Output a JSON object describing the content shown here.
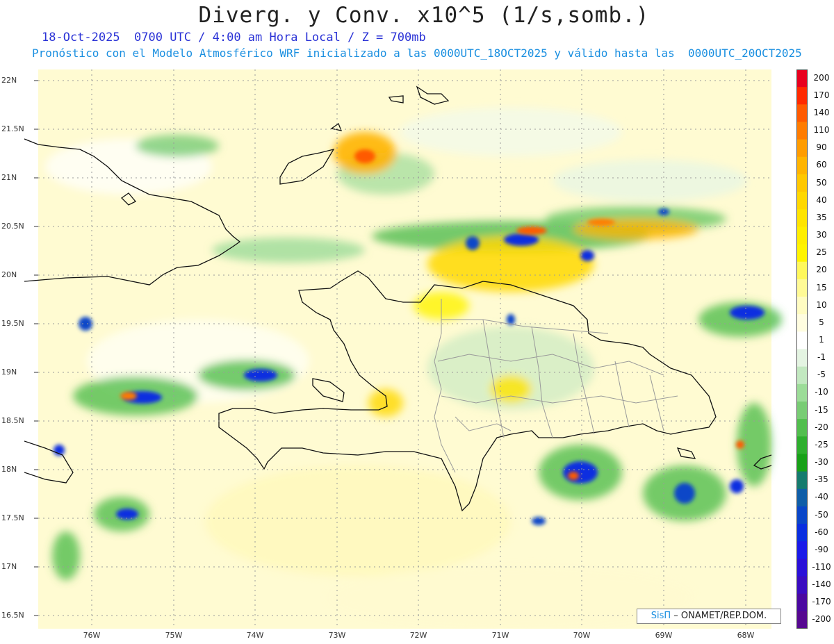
{
  "title": "Diverg. y Conv. x10^5 (1/s,somb.)",
  "subtitle_line1": "18-Oct-2025  0700 UTC / 4:00 am Hora Local / Z = 700mb",
  "subtitle_line2": "Pronóstico con el Modelo Atmosférico WRF inicializado a las 0000UTC_18OCT2025 y válido hasta las  0000UTC_20OCT2025",
  "lat_labels": [
    "22N",
    "21.5N",
    "21N",
    "20.5N",
    "20N",
    "19.5N",
    "19N",
    "18.5N",
    "18N",
    "17.5N",
    "17N",
    "16.5N"
  ],
  "lon_labels": [
    "76W",
    "75W",
    "74W",
    "73W",
    "72W",
    "71W",
    "70W",
    "69W",
    "68W"
  ],
  "colorbar": {
    "labels": [
      "200",
      "170",
      "140",
      "110",
      "90",
      "60",
      "50",
      "40",
      "35",
      "30",
      "25",
      "20",
      "15",
      "10",
      "5",
      "1",
      "-1",
      "-5",
      "-10",
      "-15",
      "-20",
      "-25",
      "-30",
      "-35",
      "-40",
      "-50",
      "-60",
      "-90",
      "-110",
      "-140",
      "-170",
      "-200"
    ],
    "colors": [
      "#e8001e",
      "#ff2a00",
      "#ff5a00",
      "#ff7c00",
      "#ff9c00",
      "#ffb400",
      "#ffc800",
      "#ffd800",
      "#ffe400",
      "#ffee00",
      "#fff400",
      "#fff85c",
      "#fffa96",
      "#fffcc2",
      "#fffde0",
      "#ffffff",
      "#e4f4e2",
      "#c2e8c0",
      "#9cdc98",
      "#78cc74",
      "#52be4e",
      "#2eae2e",
      "#18a018",
      "#157b6e",
      "#0f5ea8",
      "#0a46c8",
      "#0a2ee0",
      "#1a1ae8",
      "#2a10d8",
      "#3a0cc0",
      "#4a08a0",
      "#560890"
    ]
  },
  "credit": {
    "brand": "SisΠ",
    "text": "– ONAMET/REP.DOM."
  }
}
